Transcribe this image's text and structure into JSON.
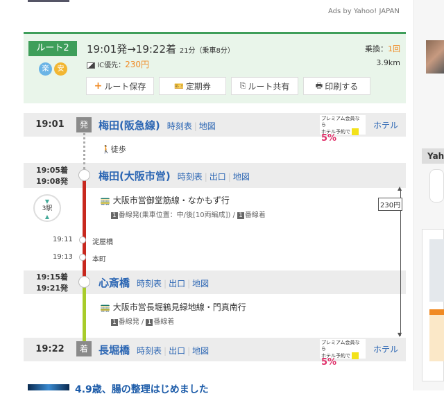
{
  "ads": {
    "label": "Ads by Yahoo! JAPAN"
  },
  "route": {
    "badge": "ルート2",
    "icons": [
      "楽",
      "安"
    ],
    "summary_times": "19:01発→19:22着",
    "duration": "21分（乗車8分）",
    "ic_label": "IC優先：",
    "fare": "230円",
    "transfers_label": "乗換：",
    "transfers": "1回",
    "distance": "3.9km",
    "buttons": [
      {
        "label": "ルート保存"
      },
      {
        "label": "定期券"
      },
      {
        "label": "ルート共有"
      },
      {
        "label": "印刷する"
      }
    ]
  },
  "stations": [
    {
      "time": "19:01",
      "badge": "発",
      "name": "梅田(阪急線)",
      "links": [
        "時刻表",
        "地図"
      ],
      "hotel": "ホテル"
    },
    {
      "time_arr": "19:05着",
      "time_dep": "19:08発",
      "name": "梅田(大阪市営)",
      "links": [
        "時刻表",
        "出口",
        "地図"
      ]
    },
    {
      "time_arr": "19:15着",
      "time_dep": "19:21発",
      "name": "心斎橋",
      "links": [
        "時刻表",
        "出口",
        "地図"
      ]
    },
    {
      "time": "19:22",
      "badge": "着",
      "name": "長堀橋",
      "links": [
        "時刻表",
        "出口",
        "地図"
      ],
      "hotel": "ホテル"
    }
  ],
  "walk": "徒歩",
  "segments": [
    {
      "line": "大阪市営御堂筋線・なかもず行",
      "num1": "1",
      "detail1": "番線発(乗車位置：中/後[10両編成]) / ",
      "num2": "1",
      "detail2": "番線着",
      "stops_count": "3駅"
    },
    {
      "line": "大阪市営長堀鶴見緑地線・門真南行",
      "num1": "1",
      "detail1": "番線発 / ",
      "num2": "1",
      "detail2": "番線着"
    }
  ],
  "intermediate": [
    {
      "time": "19:11",
      "name": "淀屋橋"
    },
    {
      "time": "19:13",
      "name": "本町"
    }
  ],
  "fare_marker": "230円",
  "promo": {
    "top": "プレミアム会員なら",
    "left": "ホテル予約で",
    "pct": "5%"
  },
  "article": {
    "title": "4.9歳、腸の整理はじめました"
  },
  "sidebar": {
    "heading": "Yah"
  },
  "colors": {
    "green": "#3e9e5a",
    "red": "#c8281e",
    "lime": "#a8cc2a",
    "orange": "#f08a24"
  }
}
